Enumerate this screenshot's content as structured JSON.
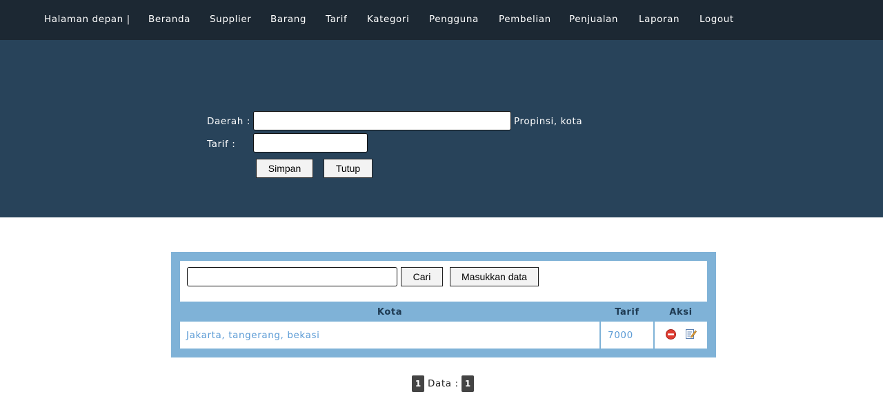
{
  "nav": {
    "items": [
      {
        "label": "Halaman depan |"
      },
      {
        "label": "Beranda"
      },
      {
        "label": "Supplier"
      },
      {
        "label": "Barang"
      },
      {
        "label": "Tarif"
      },
      {
        "label": "Kategori"
      },
      {
        "label": "Pengguna"
      },
      {
        "label": "Pembelian"
      },
      {
        "label": "Penjualan"
      },
      {
        "label": "Laporan"
      },
      {
        "label": "Logout"
      }
    ]
  },
  "form": {
    "daerah_label": "Daerah :",
    "daerah_value": "",
    "daerah_hint": "Propinsi, kota",
    "tarif_label": "Tarif :",
    "tarif_value": "",
    "save_label": "Simpan",
    "close_label": "Tutup"
  },
  "table": {
    "search_value": "",
    "search_button": "Cari",
    "add_button": "Masukkan data",
    "columns": [
      "Kota",
      "Tarif",
      "Aksi"
    ],
    "rows": [
      {
        "kota": "Jakarta, tangerang, bekasi",
        "tarif": "7000",
        "actions": [
          "delete-icon",
          "edit-icon"
        ]
      }
    ]
  },
  "pager": {
    "current_page": "1",
    "data_label": "Data :",
    "data_count": "1"
  },
  "colors": {
    "nav_bg": "#1c2833",
    "hero_bg": "#28435a",
    "panel_bg": "#7fb2d7",
    "link": "#5b9bd5",
    "header_text": "#1e3a52"
  }
}
